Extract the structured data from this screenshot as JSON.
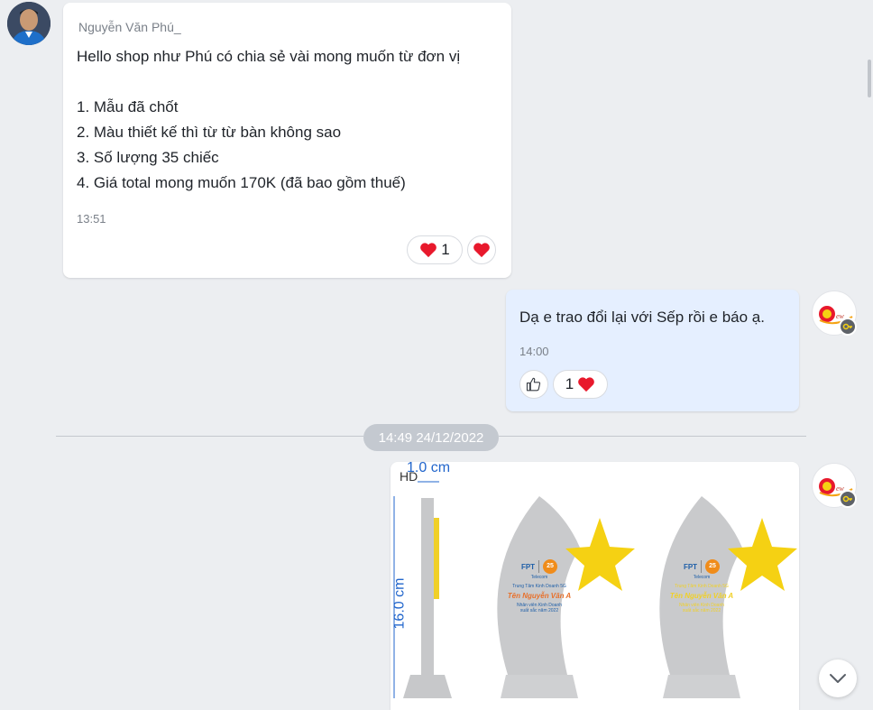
{
  "incoming": {
    "sender_name": "Nguyễn Văn Phú_",
    "lines": [
      "Hello shop như Phú có chia sẻ vài mong muốn từ đơn vị",
      "1. Mẫu đã chốt",
      "2. Màu thiết kế thì từ từ bàn không sao",
      "3. Số lượng 35 chiếc",
      "4. Giá total mong muốn 170K (đã bao gồm thuế)"
    ],
    "time": "13:51",
    "reaction_count": "1"
  },
  "outgoing": {
    "text": "Dạ e trao đổi lại với Sếp rồi e báo ạ.",
    "time": "14:00",
    "reaction_count": "1"
  },
  "date_separator": "14:49 24/12/2022",
  "image_message": {
    "quality_tag": "HD",
    "width_label": "1.0 cm",
    "height_label": "16.0 cm",
    "trophy": {
      "brand": "FPT",
      "brand_sub": "Telecom",
      "badge": "25",
      "line1": "Trung Tâm Kinh Doanh 5G",
      "name": "Tên Nguyễn Văn A",
      "line3": "Nhân viên Kinh Doanh",
      "line4": "xuất sắc năm 2022"
    }
  },
  "colors": {
    "background": "#eceef1",
    "incoming_bubble": "#ffffff",
    "outgoing_bubble": "#e5efff",
    "heart": "#e8192c",
    "star": "#f5d113",
    "date_chip": "#c4c9d0"
  },
  "icons": {
    "heart": "heart-icon",
    "like": "thumbs-up-icon",
    "scroll": "chevron-down-icon",
    "key": "key-icon"
  }
}
